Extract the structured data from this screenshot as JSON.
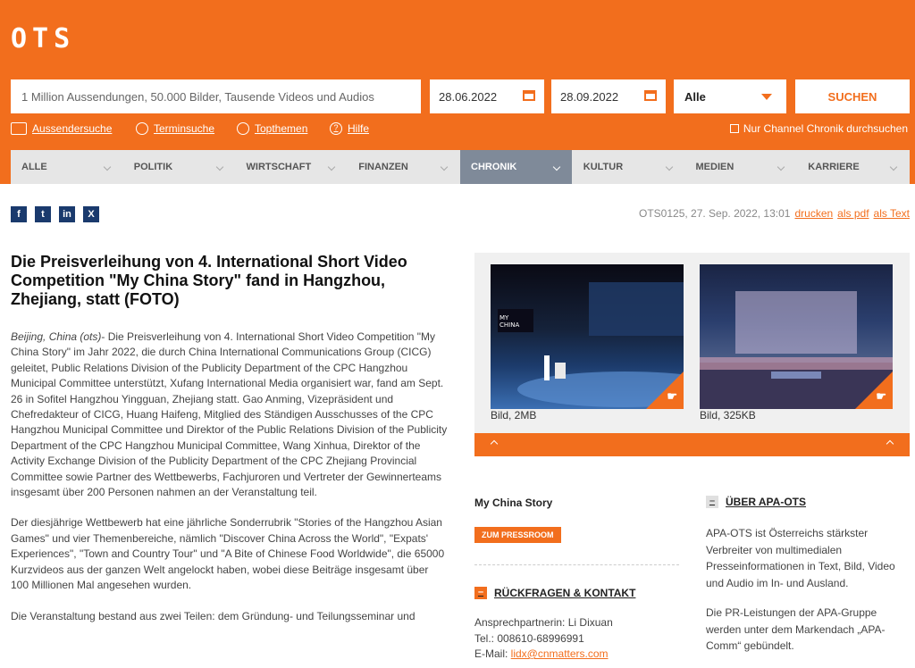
{
  "header": {
    "logo": "OTS",
    "search_placeholder": "1 Million Aussendungen, 50.000 Bilder, Tausende Videos und Audios",
    "date_from": "28.06.2022",
    "date_to": "28.09.2022",
    "filter_selected": "Alle",
    "search_button": "SUCHEN",
    "links": [
      "Aussendersuche",
      "Terminsuche",
      "Topthemen",
      "Hilfe"
    ],
    "channel_checkbox": "Nur Channel Chronik durchsuchen"
  },
  "categories": [
    "ALLE",
    "POLITIK",
    "WIRTSCHAFT",
    "FINANZEN",
    "CHRONIK",
    "KULTUR",
    "MEDIEN",
    "KARRIERE"
  ],
  "active_category": "CHRONIK",
  "meta": {
    "id_date": "OTS0125, 27. Sep. 2022, 13:01",
    "print": "drucken",
    "pdf": "als pdf",
    "text": "als Text"
  },
  "article": {
    "title": "Die Preisverleihung von 4. International Short Video Competition \"My China Story\" fand in Hangzhou, Zhejiang, statt (FOTO)",
    "lead_location": "Beijing, China (ots)",
    "para1": "- Die Preisverleihung von 4. International Short Video Competition \"My China Story\" im Jahr 2022, die durch China International Communications Group (CICG) geleitet, Public Relations Division of the Publicity Department of the CPC Hangzhou Municipal Committee unterstützt, Xufang International Media organisiert war, fand am Sept. 26 in Sofitel Hangzhou Yingguan, Zhejiang statt. Gao Anming, Vizepräsident und Chefredakteur of CICG, Huang Haifeng, Mitglied des Ständigen Ausschusses of the CPC Hangzhou Municipal Committee und Direktor of the Public Relations Division of the Publicity Department of the CPC Hangzhou Municipal Committee, Wang Xinhua, Direktor of the Activity Exchange Division of the Publicity Department of the CPC Zhejiang Provincial Committee sowie Partner des Wettbewerbs, Fachjuroren und Vertreter der Gewinnerteams insgesamt über 200 Personen nahmen an der Veranstaltung teil.",
    "para2": "Der diesjährige Wettbewerb hat eine jährliche Sonderrubrik \"Stories of the Hangzhou Asian Games\" und vier Themenbereiche, nämlich \"Discover China Across the World\", \"Expats' Experiences\", \"Town and Country Tour\" und \"A Bite of Chinese Food Worldwide\", die 65000 Kurzvideos aus der ganzen Welt angelockt haben, wobei diese Beiträge insgesamt über 100 Millionen Mal angesehen wurden.",
    "para3": "Die Veranstaltung bestand aus zwei Teilen: dem Gründung- und Teilungsseminar und"
  },
  "gallery": {
    "image1_label": "Bild, 2MB",
    "image2_label": "Bild, 325KB"
  },
  "sidebar": {
    "company": "My China Story",
    "pressroom_button": "ZUM PRESSROOM",
    "contact_heading": "RÜCKFRAGEN & KONTAKT",
    "contact_person": "Ansprechpartnerin: Li Dixuan",
    "contact_phone": "Tel.: 008610-68996991",
    "contact_email_label": "E-Mail: ",
    "contact_email": "lidx@cnmatters.com",
    "about_heading": "ÜBER APA-OTS",
    "about_p1": "APA-OTS ist Österreichs stärkster Verbreiter von multimedialen Presseinformationen in Text, Bild, Video und Audio im In- und Ausland.",
    "about_p2": "Die PR-Leistungen der APA-Gruppe werden unter dem Markendach „APA-Comm“ gebündelt."
  },
  "colors": {
    "brand": "#f26e1d",
    "active_tab": "#7f8a99"
  }
}
